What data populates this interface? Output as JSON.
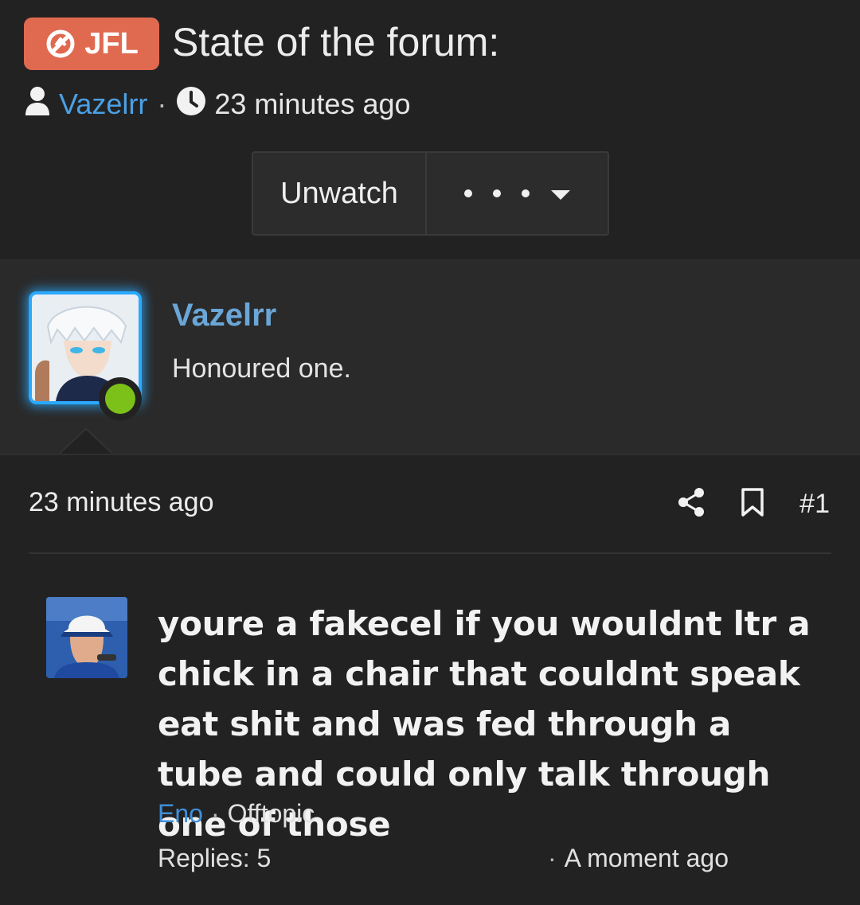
{
  "thread": {
    "prefix": "JFL",
    "title": "State of the forum:",
    "author": "Vazelrr",
    "time": "23 minutes ago",
    "separator": "·"
  },
  "actions": {
    "unwatch_label": "Unwatch"
  },
  "user": {
    "name": "Vazelrr",
    "title": "Honoured one.",
    "status": "online"
  },
  "post": {
    "time": "23 minutes ago",
    "number": "#1"
  },
  "preview": {
    "title": "youre a fakecel if you wouldnt ltr a chick in a chair that couldnt speak eat shit and was fed through a tube and could only talk through one of those",
    "author": "Eno",
    "separator": "·",
    "forum": "Offtopic",
    "replies": "Replies: 5",
    "time_separator": "·",
    "time": "A moment ago"
  },
  "colors": {
    "background": "#222222",
    "prefix_badge": "#e06a50",
    "link": "#4aa0e6",
    "username": "#6aa6d8",
    "avatar_glow": "#2aa9ff",
    "online": "#7cc11a"
  },
  "icons": [
    "no-ascend-icon",
    "user-icon",
    "clock-icon",
    "share-icon",
    "bookmark-icon",
    "chevron-down-icon"
  ]
}
